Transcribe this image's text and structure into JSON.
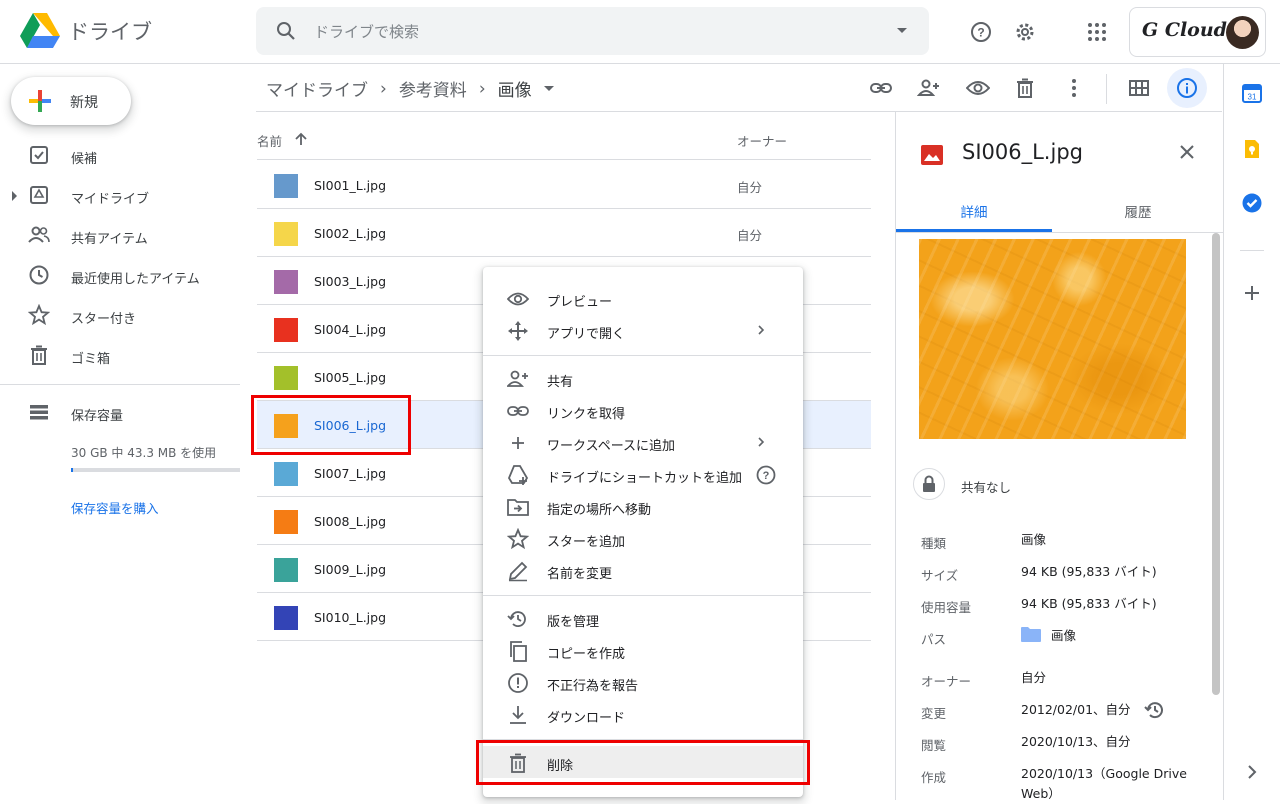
{
  "header": {
    "app_title": "ドライブ",
    "search_placeholder": "ドライブで検索",
    "account_brand": "G Cloud"
  },
  "sidebar": {
    "new_label": "新規",
    "items": [
      {
        "label": "候補",
        "icon": "checkbox-icon"
      },
      {
        "label": "マイドライブ",
        "icon": "my-drive-icon"
      },
      {
        "label": "共有アイテム",
        "icon": "shared-icon"
      },
      {
        "label": "最近使用したアイテム",
        "icon": "clock-icon"
      },
      {
        "label": "スター付き",
        "icon": "star-icon"
      },
      {
        "label": "ゴミ箱",
        "icon": "trash-icon"
      }
    ],
    "storage_label": "保存容量",
    "storage_used": "30 GB 中 43.3 MB を使用",
    "storage_fraction": 0.0014,
    "buy_storage": "保存容量を購入"
  },
  "breadcrumb": {
    "root": "マイドライブ",
    "parent": "参考資料",
    "current": "画像"
  },
  "list": {
    "col_name": "名前",
    "col_owner": "オーナー",
    "files": [
      {
        "name": "SI001_L.jpg",
        "owner": "自分",
        "color": "#6699cc"
      },
      {
        "name": "SI002_L.jpg",
        "owner": "自分",
        "color": "#f5d64a"
      },
      {
        "name": "SI003_L.jpg",
        "owner": "",
        "color": "#a46aa8"
      },
      {
        "name": "SI004_L.jpg",
        "owner": "",
        "color": "#e8311f"
      },
      {
        "name": "SI005_L.jpg",
        "owner": "",
        "color": "#a3c02a"
      },
      {
        "name": "SI006_L.jpg",
        "owner": "",
        "color": "#f5a11c"
      },
      {
        "name": "SI007_L.jpg",
        "owner": "",
        "color": "#5aa9d6"
      },
      {
        "name": "SI008_L.jpg",
        "owner": "",
        "color": "#f57c14"
      },
      {
        "name": "SI009_L.jpg",
        "owner": "",
        "color": "#3aa39a"
      },
      {
        "name": "SI010_L.jpg",
        "owner": "",
        "color": "#3344b6"
      }
    ]
  },
  "menu": {
    "items": [
      {
        "label": "プレビュー",
        "icon": "eye-icon"
      },
      {
        "label": "アプリで開く",
        "icon": "move-arrows-icon"
      },
      {
        "label": "共有",
        "icon": "person-add-icon"
      },
      {
        "label": "リンクを取得",
        "icon": "link-icon"
      },
      {
        "label": "ワークスペースに追加",
        "icon": "plus-icon"
      },
      {
        "label": "ドライブにショートカットを追加",
        "icon": "drive-shortcut-icon"
      },
      {
        "label": "指定の場所へ移動",
        "icon": "move-folder-icon"
      },
      {
        "label": "スターを追加",
        "icon": "star-icon"
      },
      {
        "label": "名前を変更",
        "icon": "pencil-icon"
      },
      {
        "label": "版を管理",
        "icon": "history-icon"
      },
      {
        "label": "コピーを作成",
        "icon": "copy-icon"
      },
      {
        "label": "不正行為を報告",
        "icon": "report-icon"
      },
      {
        "label": "ダウンロード",
        "icon": "download-icon"
      },
      {
        "label": "削除",
        "icon": "trash-icon"
      }
    ]
  },
  "details": {
    "title": "SI006_L.jpg",
    "tab_details": "詳細",
    "tab_history": "履歴",
    "share_status": "共有なし",
    "rows": [
      {
        "k": "種類",
        "v": "画像"
      },
      {
        "k": "サイズ",
        "v": "94 KB (95,833 バイト)"
      },
      {
        "k": "使用容量",
        "v": "94 KB (95,833 バイト)"
      },
      {
        "k": "パス",
        "v": "画像"
      },
      {
        "k": "オーナー",
        "v": "自分"
      },
      {
        "k": "変更",
        "v": "2012/02/01、自分"
      },
      {
        "k": "閲覧",
        "v": "2020/10/13、自分"
      },
      {
        "k": "作成",
        "v": "2020/10/13（Google Drive Web）"
      }
    ],
    "preview_color": "#f3a21a"
  },
  "colors": {
    "accent": "#1a73e8",
    "highlight": "#e00000"
  }
}
